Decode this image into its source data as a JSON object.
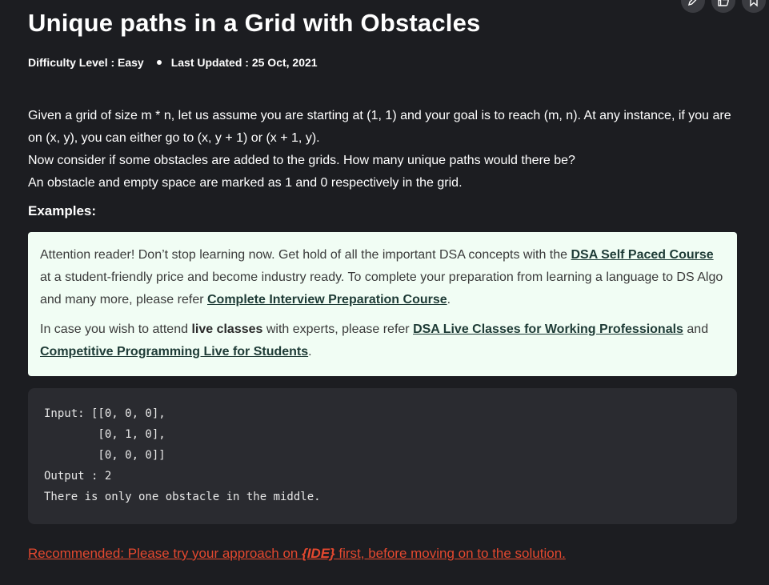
{
  "article": {
    "title": "Unique paths in a Grid with Obstacles",
    "difficulty": "Difficulty Level : Easy",
    "updated": "Last Updated : 25 Oct, 2021"
  },
  "description": {
    "para1": "Given a grid of size m * n, let us assume you are starting at (1, 1) and your goal is to reach (m, n). At any instance, if you are on (x, y), you can either go to (x, y + 1) or (x + 1, y).",
    "para2": "Now consider if some obstacles are added to the grids. How many unique paths would there be?",
    "para3": "An obstacle and empty space are marked as 1 and 0 respectively in the grid."
  },
  "examples_heading": "Examples:",
  "notice": {
    "p1_text_a": "Attention reader! Don’t stop learning now. Get hold of all the important DSA concepts with the ",
    "p1_link1": "DSA Self Paced Course",
    "p1_text_b": " at a student-friendly price and become industry ready.  To complete your preparation from learning a language to DS Algo and many more,  please refer ",
    "p1_link2": "Complete Interview Preparation Course",
    "p1_text_c": ".",
    "p2_text_a": "In case you wish to attend ",
    "p2_bold": "live classes",
    "p2_text_b": " with experts, please refer ",
    "p2_link1": "DSA Live Classes for Working Professionals",
    "p2_text_c": " and ",
    "p2_link2": "Competitive Programming Live for Students",
    "p2_text_d": "."
  },
  "code": {
    "lines": [
      "Input: [[0, 0, 0],",
      "        [0, 1, 0],",
      "        [0, 0, 0]]",
      "Output : 2",
      "There is only one obstacle in the middle."
    ]
  },
  "recommend": {
    "text_a": "Recommended: Please try your approach on ",
    "ide": "{IDE}",
    "text_b": " first, before moving on to the solution."
  },
  "icons": {
    "edit": "pencil-icon",
    "like": "thumbs-up-icon",
    "bookmark": "bookmark-icon"
  },
  "colors": {
    "background": "#1c1d21",
    "notice_bg": "#f1fdf4",
    "code_bg": "#2a2b30",
    "recommend": "#e3482f"
  }
}
